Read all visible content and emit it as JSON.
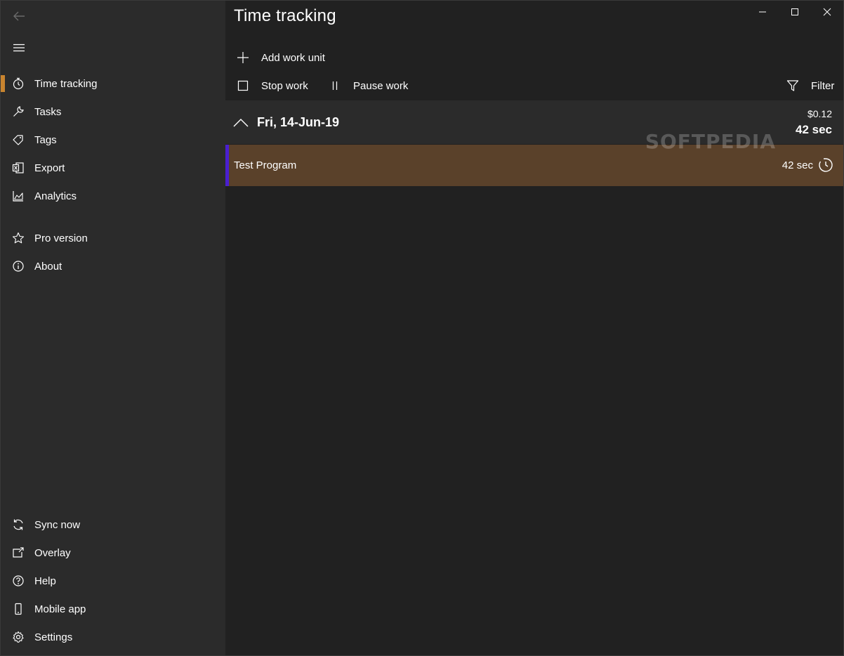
{
  "colors": {
    "accent": "#c8842f",
    "task_color": "#4a1fd0",
    "entry_bg": "#5a412a",
    "sidebar_bg": "#2b2b2b",
    "main_bg": "#212121"
  },
  "sidebar": {
    "top_items": [
      {
        "label": "Time tracking",
        "icon": "stopwatch-icon",
        "active": true
      },
      {
        "label": "Tasks",
        "icon": "wrench-icon"
      },
      {
        "label": "Tags",
        "icon": "tag-icon"
      },
      {
        "label": "Export",
        "icon": "excel-icon"
      },
      {
        "label": "Analytics",
        "icon": "area-chart-icon"
      },
      {
        "label": "Pro version",
        "icon": "star-icon"
      },
      {
        "label": "About",
        "icon": "info-icon"
      }
    ],
    "bottom_items": [
      {
        "label": "Sync now",
        "icon": "sync-icon"
      },
      {
        "label": "Overlay",
        "icon": "overlay-icon"
      },
      {
        "label": "Help",
        "icon": "help-icon"
      },
      {
        "label": "Mobile app",
        "icon": "phone-icon"
      },
      {
        "label": "Settings",
        "icon": "gear-icon"
      }
    ]
  },
  "header": {
    "title": "Time tracking"
  },
  "toolbar": {
    "add_label": "Add work unit",
    "stop_label": "Stop work",
    "pause_label": "Pause work",
    "filter_label": "Filter"
  },
  "group": {
    "date": "Fri, 14-Jun-19",
    "amount": "$0.12",
    "total": "42 sec"
  },
  "entries": [
    {
      "name": "Test Program",
      "duration": "42 sec"
    }
  ],
  "watermark": "SOFTPEDIA"
}
